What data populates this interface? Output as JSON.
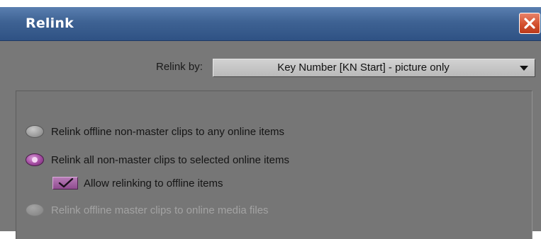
{
  "window": {
    "title": "Relink"
  },
  "relink_by": {
    "label": "Relink by:",
    "selected": "Key Number [KN Start] - picture only"
  },
  "options": [
    {
      "label": "Relink offline non-master clips to any online items",
      "state": "unselected"
    },
    {
      "label": "Relink all non-master clips to selected online items",
      "state": "selected"
    },
    {
      "label": "Relink offline master clips to online media files",
      "state": "disabled"
    }
  ],
  "allow_offline": {
    "label": "Allow relinking to offline items",
    "checked": true
  },
  "colors": {
    "titlebar": "#3e6293",
    "body": "#787878",
    "accent_purple": "#a24aa0",
    "close_red": "#d4502e"
  }
}
